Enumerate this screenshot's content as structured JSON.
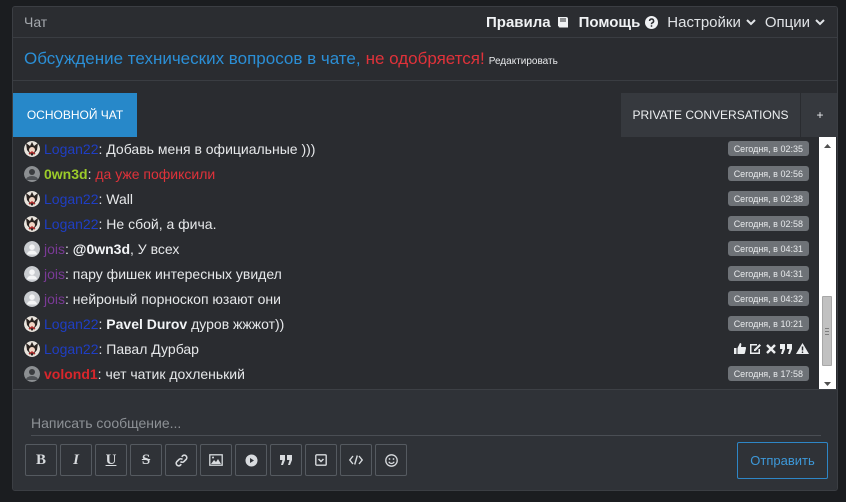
{
  "header": {
    "title": "Чат",
    "nav": [
      {
        "label": "Правила",
        "icon": "book-icon"
      },
      {
        "label": "Помощь",
        "icon": "question-circle-icon"
      },
      {
        "label": "Настройки",
        "icon": "chevron-down-icon"
      },
      {
        "label": "Опции",
        "icon": "chevron-down-icon"
      }
    ]
  },
  "notice": {
    "blue_text": "Обсуждение технических вопросов в чате,",
    "red_text": "не одобряется!",
    "edit_label": "Редактировать"
  },
  "tabs": {
    "main": "ОСНОВНОЙ ЧАТ",
    "private": "PRIVATE CONVERSATIONS",
    "add": "+"
  },
  "colors": {
    "accent": "#2788c9",
    "user_blue": "#1f3ec4",
    "user_green": "#9ccc2a",
    "user_purple": "#7a3a96",
    "user_red": "#d8262b",
    "notice_red": "#e0323a",
    "notice_blue": "#2b8fd6"
  },
  "messages": [
    {
      "user": "Logan22",
      "user_color": "#1f3ec4",
      "avatar": "anime",
      "text": "Добавь меня в официальные )))",
      "text_color": "#e6e8ea",
      "time": "Сегодня, в 02:35"
    },
    {
      "user": "0wn3d",
      "user_color": "#9ccc2a",
      "avatar": "photo",
      "text": "да уже пофиксили",
      "text_color": "#e0323a",
      "time": "Сегодня, в 02:56"
    },
    {
      "user": "Logan22",
      "user_color": "#1f3ec4",
      "avatar": "anime",
      "text": "Wall",
      "text_color": "#e6e8ea",
      "time": "Сегодня, в 02:38"
    },
    {
      "user": "Logan22",
      "user_color": "#1f3ec4",
      "avatar": "anime",
      "text": "Не сбой, а фича.",
      "text_color": "#e6e8ea",
      "time": "Сегодня, в 02:58"
    },
    {
      "user": "jois",
      "user_color": "#7a3a96",
      "avatar": "default",
      "mention": "@0wn3d",
      "text": ", У всех",
      "text_color": "#e6e8ea",
      "time": "Сегодня, в 04:31"
    },
    {
      "user": "jois",
      "user_color": "#7a3a96",
      "avatar": "default",
      "text": "пару фишек интересных увидел",
      "text_color": "#e6e8ea",
      "time": "Сегодня, в 04:31"
    },
    {
      "user": "jois",
      "user_color": "#7a3a96",
      "avatar": "default",
      "text": "нейроный порноскоп юзают они",
      "text_color": "#e6e8ea",
      "time": "Сегодня, в 04:32"
    },
    {
      "user": "Logan22",
      "user_color": "#1f3ec4",
      "avatar": "anime",
      "mention": "Pavel Durov",
      "text": " дуров жжжот))",
      "text_color": "#e6e8ea",
      "time": "Сегодня, в 10:21"
    },
    {
      "user": "Logan22",
      "user_color": "#1f3ec4",
      "avatar": "anime",
      "text": "Павал Дурбар",
      "text_color": "#e6e8ea",
      "time": "",
      "actions": [
        "thumbs-up-icon",
        "edit-icon",
        "delete-icon",
        "quote-icon",
        "report-icon"
      ]
    },
    {
      "user": "volond1",
      "user_color": "#d8262b",
      "avatar": "photo",
      "text": "чет чатик дохленький",
      "text_color": "#e6e8ea",
      "time": "Сегодня, в 17:58"
    }
  ],
  "composer": {
    "placeholder": "Написать сообщение...",
    "tools": [
      "bold-icon",
      "italic-icon",
      "underline-icon",
      "strike-icon",
      "link-icon",
      "image-icon",
      "media-icon",
      "quote-icon",
      "spoiler-icon",
      "code-icon",
      "smile-icon"
    ],
    "tool_glyphs": {
      "bold-icon": "B",
      "italic-icon": "I",
      "underline-icon": "U",
      "strike-icon": "S"
    },
    "send_label": "Отправить"
  }
}
